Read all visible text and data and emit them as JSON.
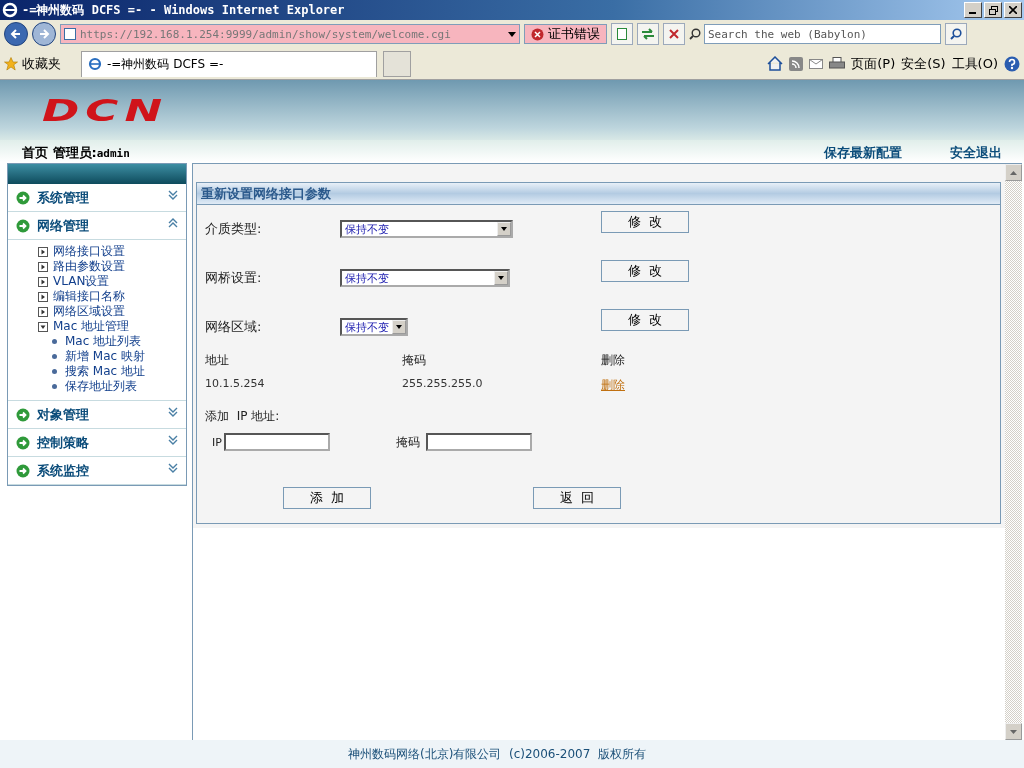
{
  "window": {
    "title": "-=神州数码 DCFS =- - Windows Internet Explorer"
  },
  "address_bar": {
    "url": "https://192.168.1.254:9999/admin/show/system/welcome.cgi",
    "cert_error": "证书错误"
  },
  "search": {
    "placeholder": "Search the web (Babylon)"
  },
  "favorites": {
    "label": "收藏夹"
  },
  "tabs": [
    {
      "label": "-=神州数码 DCFS =-",
      "selected": true
    }
  ],
  "command_bar": [
    {
      "label": "页面(P)"
    },
    {
      "label": "安全(S)"
    },
    {
      "label": "工具(O)"
    }
  ],
  "banner": {
    "logo": "DCN"
  },
  "top_nav": {
    "home": "首页",
    "admin_label": "管理员:",
    "admin": "admin",
    "links": [
      "保存最新配置",
      "安全退出"
    ]
  },
  "sidebar": {
    "sections": [
      {
        "label": "系统管理",
        "expanded": false
      },
      {
        "label": "网络管理",
        "expanded": true,
        "children": [
          {
            "label": "网络接口设置",
            "expanded": false
          },
          {
            "label": "路由参数设置",
            "expanded": false
          },
          {
            "label": "VLAN设置",
            "expanded": false
          },
          {
            "label": "编辑接口名称",
            "expanded": false
          },
          {
            "label": "网络区域设置",
            "expanded": false
          },
          {
            "label": "Mac 地址管理",
            "expanded": true,
            "children": [
              {
                "label": "Mac 地址列表"
              },
              {
                "label": "新增 Mac 映射"
              },
              {
                "label": "搜索 Mac 地址"
              },
              {
                "label": "保存地址列表"
              }
            ]
          }
        ]
      },
      {
        "label": "对象管理",
        "expanded": false
      },
      {
        "label": "控制策略",
        "expanded": false
      },
      {
        "label": "系统监控",
        "expanded": false
      }
    ]
  },
  "panel": {
    "title": "重新设置网络接口参数",
    "settings": [
      {
        "label": "介质类型:",
        "value": "保持不变",
        "kind": "long",
        "button": "修  改"
      },
      {
        "label": "网桥设置:",
        "value": "保持不变",
        "kind": "medium",
        "button": "修  改"
      },
      {
        "label": "网络区域:",
        "value": "保持不变",
        "kind": "short",
        "button": "修  改"
      }
    ],
    "table": {
      "columns": [
        "地址",
        "掩码",
        "删除"
      ],
      "rows": [
        {
          "address": "10.1.5.254",
          "mask": "255.255.255.0",
          "action": "删除"
        }
      ]
    },
    "add_label": "添加  IP 地址:",
    "ip_label": "IP",
    "mask_label": "掩码",
    "buttons": [
      "添  加",
      "返  回"
    ]
  },
  "footer": "神州数码网络(北京)有限公司  (c)2006-2007  版权所有"
}
